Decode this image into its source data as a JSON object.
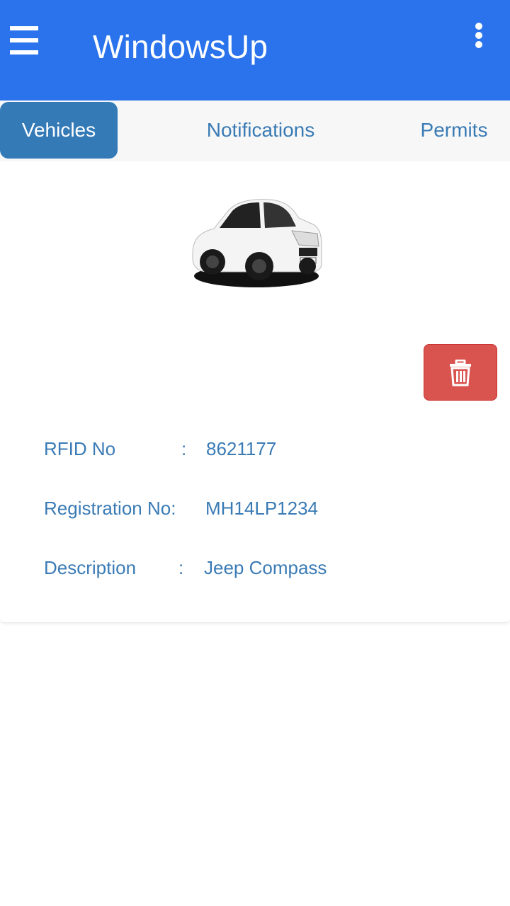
{
  "app_bar": {
    "title": "WindowsUp",
    "menu_icon": "hamburger-menu-icon",
    "overflow_icon": "more-vertical-icon",
    "color": "#2a73ec"
  },
  "tabs": [
    {
      "label": "Vehicles",
      "active": true
    },
    {
      "label": "Notifications",
      "active": false
    },
    {
      "label": "Permits",
      "active": false
    }
  ],
  "vehicle": {
    "image_icon": "car-photo",
    "delete_icon": "trash-icon",
    "delete_color": "#d9534f",
    "fields": [
      {
        "label": "RFID No",
        "separator": ":",
        "value": "8621177"
      },
      {
        "label": "Registration No:",
        "separator": "",
        "value": "MH14LP1234"
      },
      {
        "label": "Description",
        "separator": ":",
        "value": "Jeep Compass"
      }
    ]
  }
}
